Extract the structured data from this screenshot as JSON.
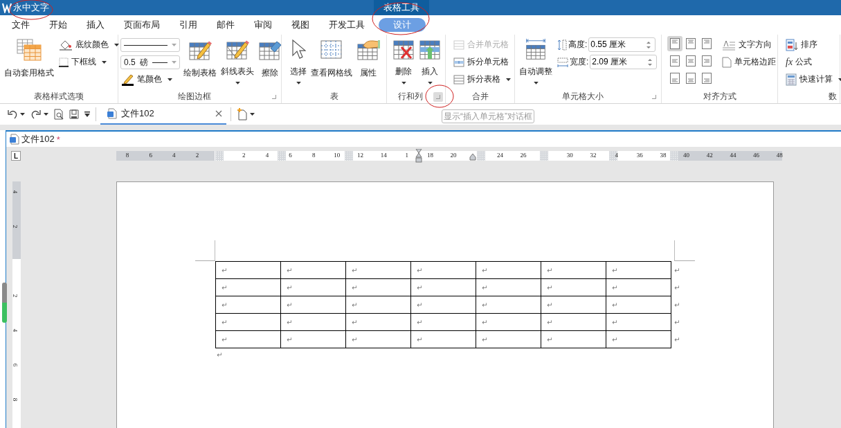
{
  "title_bar": {
    "app_name": "永中文字",
    "context_tab": "表格工具"
  },
  "menu_tabs": [
    {
      "label": "文件",
      "selected": false
    },
    {
      "label": "开始",
      "selected": false
    },
    {
      "label": "插入",
      "selected": false
    },
    {
      "label": "页面布局",
      "selected": false
    },
    {
      "label": "引用",
      "selected": false
    },
    {
      "label": "邮件",
      "selected": false
    },
    {
      "label": "审阅",
      "selected": false
    },
    {
      "label": "视图",
      "selected": false
    },
    {
      "label": "开发工具",
      "selected": false
    },
    {
      "label": "设计",
      "selected": true
    }
  ],
  "ribbon": {
    "groups": [
      {
        "kind": "styles",
        "label": "表格样式选项",
        "buttons": [
          {
            "label": "自动套用格式",
            "dropdown": false
          },
          {
            "label": "底纹颜色",
            "dropdown": true
          },
          {
            "label": "下框线",
            "dropdown": true
          }
        ]
      },
      {
        "kind": "borders",
        "label": "绘图边框",
        "launcher": {
          "hovered": false
        },
        "weight": "0.5",
        "weight_unit": "磅",
        "buttons": [
          {
            "label": "笔颜色",
            "dropdown": true
          },
          {
            "label": "绘制表格",
            "dropdown": false
          },
          {
            "label": "斜线表头",
            "dropdown": true
          },
          {
            "label": "擦除",
            "dropdown": false
          }
        ]
      },
      {
        "kind": "table",
        "label": "表",
        "buttons": [
          {
            "label": "选择",
            "dropdown": true
          },
          {
            "label": "查看网格线",
            "dropdown": false
          },
          {
            "label": "属性",
            "dropdown": false
          }
        ]
      },
      {
        "kind": "rows",
        "label": "行和列",
        "launcher": {
          "hovered": true
        },
        "buttons": [
          {
            "label": "删除",
            "dropdown": true
          },
          {
            "label": "插入",
            "dropdown": true
          }
        ]
      },
      {
        "kind": "merge",
        "label": "合并",
        "buttons": [
          {
            "label": "合并单元格",
            "disabled": true,
            "dropdown": false
          },
          {
            "label": "拆分单元格",
            "disabled": false,
            "dropdown": false
          },
          {
            "label": "拆分表格",
            "disabled": false,
            "dropdown": true
          }
        ]
      },
      {
        "kind": "size",
        "label": "单元格大小",
        "launcher": {
          "hovered": false
        },
        "buttons": [
          {
            "label": "自动调整",
            "dropdown": true
          }
        ],
        "fields": [
          {
            "label": "高度:",
            "value": "0.55 厘米"
          },
          {
            "label": "宽度:",
            "value": "2.09 厘米"
          }
        ]
      },
      {
        "kind": "align",
        "label": "对齐方式",
        "alignments": [
          {
            "selected": true
          },
          {
            "selected": false
          },
          {
            "selected": false
          },
          {
            "selected": false
          },
          {
            "selected": false
          },
          {
            "selected": false
          },
          {
            "selected": false
          },
          {
            "selected": false
          },
          {
            "selected": false
          }
        ],
        "buttons": [
          {
            "label": "文字方向"
          },
          {
            "label": "单元格边距"
          }
        ]
      },
      {
        "kind": "data",
        "label": "数",
        "buttons": [
          {
            "label": "排序",
            "dropdown": false
          },
          {
            "label": "公式",
            "icon_text": "fx",
            "dropdown": false
          },
          {
            "label": "快速计算",
            "dropdown": true
          }
        ]
      }
    ]
  },
  "document_tab": {
    "title": "文件102",
    "selected": true
  },
  "tooltip": "显示“插入单元格”对话框",
  "document": {
    "title": "文件102",
    "modified_mark": "*",
    "tab_selector": "L",
    "ruler_labels": [
      "8",
      "6",
      "4",
      "2",
      "2",
      "4",
      "6",
      "8",
      "10",
      "12",
      "14",
      "1",
      "18",
      "20",
      "24",
      "26",
      "30",
      "32",
      "4",
      "36",
      "38",
      "40",
      "42",
      "44",
      "46",
      "48"
    ],
    "vertical_ruler_labels": [
      "4",
      "2",
      "2",
      "4",
      "6",
      "8"
    ],
    "table": {
      "rows": [
        {
          "cells": [
            "↵",
            "↵",
            "↵",
            "↵",
            "↵",
            "↵",
            "↵"
          ],
          "end_mark": "↵"
        },
        {
          "cells": [
            "↵",
            "↵",
            "↵",
            "↵",
            "↵",
            "↵",
            "↵"
          ],
          "end_mark": "↵"
        },
        {
          "cells": [
            "↵",
            "↵",
            "↵",
            "↵",
            "↵",
            "↵",
            "↵"
          ],
          "end_mark": "↵"
        },
        {
          "cells": [
            "↵",
            "↵",
            "↵",
            "↵",
            "↵",
            "↵",
            "↵"
          ],
          "end_mark": "↵"
        },
        {
          "cells": [
            "↵",
            "↵",
            "↵",
            "↵",
            "↵",
            "↵",
            "↵"
          ],
          "end_mark": "↵"
        }
      ]
    },
    "paragraph_mark": "↵"
  }
}
